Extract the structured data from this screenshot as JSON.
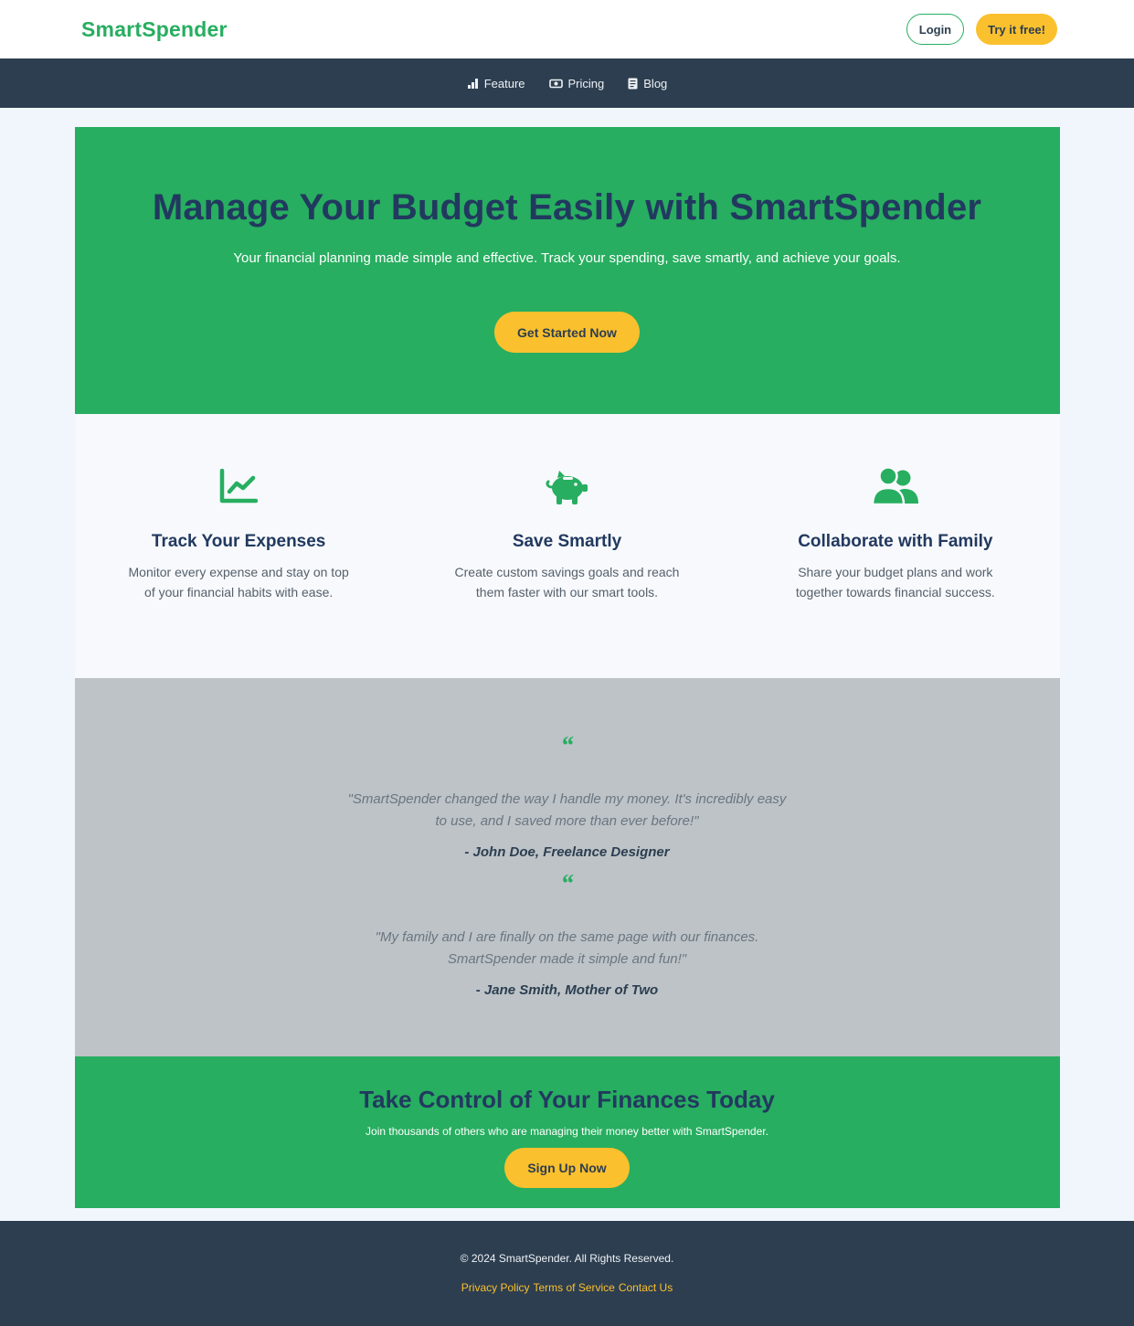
{
  "header": {
    "brand": "SmartSpender",
    "login_label": "Login",
    "try_label": "Try it free!"
  },
  "nav": {
    "items": [
      {
        "label": "Feature",
        "icon": "bar-chart-icon"
      },
      {
        "label": "Pricing",
        "icon": "money-bill-icon"
      },
      {
        "label": "Blog",
        "icon": "document-icon"
      }
    ]
  },
  "hero": {
    "title": "Manage Your Budget Easily with SmartSpender",
    "subtitle": "Your financial planning made simple and effective. Track your spending, save smartly, and achieve your goals.",
    "button_label": "Get Started Now"
  },
  "features": [
    {
      "icon": "line-chart-icon",
      "title": "Track Your Expenses",
      "text": "Monitor every expense and stay on top of your financial habits with ease."
    },
    {
      "icon": "piggy-bank-icon",
      "title": "Save Smartly",
      "text": "Create custom savings goals and reach them faster with our smart tools."
    },
    {
      "icon": "users-icon",
      "title": "Collaborate with Family",
      "text": "Share your budget plans and work together towards financial success."
    }
  ],
  "testimonials": [
    {
      "quote_mark": "“",
      "text": "\"SmartSpender changed the way I handle my money. It's incredibly easy to use, and I saved more than ever before!\"",
      "author": "- John Doe, Freelance Designer"
    },
    {
      "quote_mark": "“",
      "text": "\"My family and I are finally on the same page with our finances. SmartSpender made it simple and fun!\"",
      "author": "- Jane Smith, Mother of Two"
    }
  ],
  "cta": {
    "title": "Take Control of Your Finances Today",
    "subtitle": "Join thousands of others who are managing their money better with SmartSpender.",
    "button_label": "Sign Up Now"
  },
  "footer": {
    "copyright": "© 2024 SmartSpender. All Rights Reserved.",
    "links": [
      "Privacy Policy",
      "Terms of Service",
      "Contact Us"
    ]
  },
  "colors": {
    "primary_green": "#27ae60",
    "accent_yellow": "#fbc02d",
    "dark_navy": "#2d3e50",
    "heading_blue": "#22395f"
  }
}
